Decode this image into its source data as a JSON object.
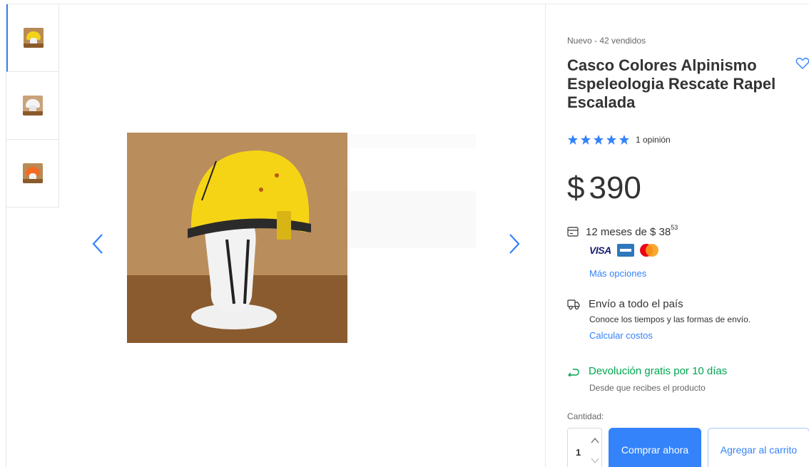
{
  "gallery": {
    "thumbnails": [
      {
        "name": "thumb-yellow-helmet",
        "helmet_color": "#f2d21b",
        "active": true
      },
      {
        "name": "thumb-white-helmet",
        "helmet_color": "#f4f4f4",
        "active": false
      },
      {
        "name": "thumb-orange-helmet",
        "helmet_color": "#f26b22",
        "active": false
      }
    ],
    "main_photo_helmet_color": "#f5d416"
  },
  "product": {
    "subtitle": "Nuevo - 42 vendidos",
    "title": "Casco Colores Alpinismo Espeleologia Rescate Rapel Escalada",
    "rating": 5,
    "reviews_label": "1 opinión",
    "price_currency": "$",
    "price_amount": "390"
  },
  "payment": {
    "installments_text": "12 meses de $ 38",
    "installments_cents": "53",
    "visa_label": "VISA",
    "more_options": "Más opciones"
  },
  "shipping": {
    "title": "Envío a todo el país",
    "subtitle": "Conoce los tiempos y las formas de envío.",
    "link": "Calcular costos"
  },
  "returns": {
    "title": "Devolución gratis por 10 días",
    "subtitle": "Desde que recibes el producto"
  },
  "purchase": {
    "quantity_label": "Cantidad:",
    "quantity_value": "1",
    "buy_now": "Comprar ahora",
    "add_to_cart": "Agregar al carrito"
  },
  "colors": {
    "accent": "#3483fa",
    "success": "#00a650",
    "star": "#3483fa"
  }
}
